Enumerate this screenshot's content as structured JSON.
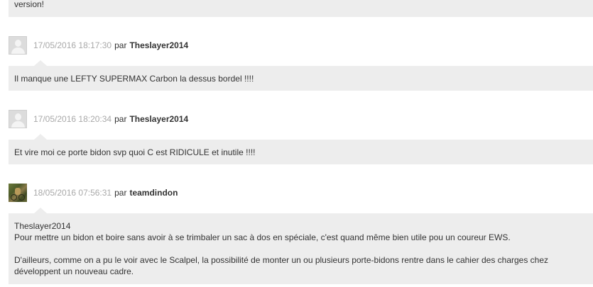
{
  "comments": [
    {
      "partial_text": "version!"
    },
    {
      "date": "17/05/2016 18:17:30",
      "par": "par",
      "author": "Theslayer2014",
      "lines": [
        "Il manque une LEFTY SUPERMAX Carbon la dessus bordel !!!!"
      ]
    },
    {
      "date": "17/05/2016 18:20:34",
      "par": "par",
      "author": "Theslayer2014",
      "lines": [
        "Et vire moi ce porte bidon svp quoi C est RIDICULE et inutile !!!!"
      ]
    },
    {
      "date": "18/05/2016 07:56:31",
      "par": "par",
      "author": "teamdindon",
      "lines": [
        "Theslayer2014",
        "Pour mettre un bidon et boire sans avoir à se trimbaler un sac à dos en spéciale, c'est quand même bien utile pou un coureur EWS.",
        "D'ailleurs, comme on a pu le voir avec le Scalpel, la possibilité de monter un ou plusieurs porte-bidons rentre dans le cahier des charges chez",
        "développent un nouveau cadre."
      ]
    }
  ]
}
